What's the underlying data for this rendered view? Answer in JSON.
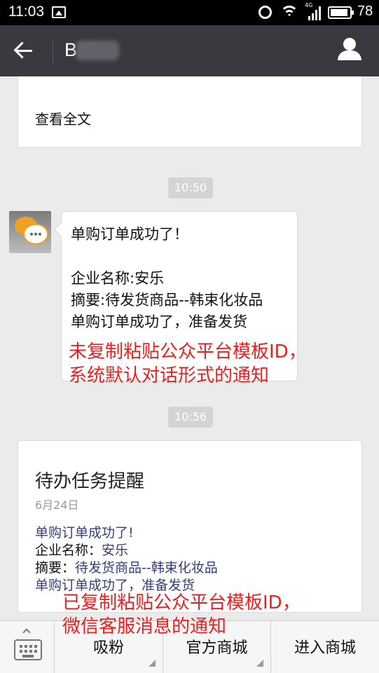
{
  "status_bar": {
    "time": "11:03",
    "network_label": "4G",
    "battery_level": "78"
  },
  "title_bar": {
    "chat_title": "B     S"
  },
  "messages": {
    "top_card": {
      "read_more": "查看全文"
    },
    "timestamp_1": "10:50",
    "bubble_lines": [
      "单购订单成功了！",
      "企业名称:安乐",
      "摘要:待发货商品--韩束化妆品",
      "单购订单成功了，准备发货"
    ],
    "annotation_1": [
      "未复制粘贴公众平台模板ID，",
      "系统默认对话形式的通知"
    ],
    "timestamp_2": "10:56",
    "template_card": {
      "title": "待办任务提醒",
      "date": "6月24日",
      "first": "单购订单成功了!",
      "company_key": "企业名称：",
      "company_val": "安乐",
      "summary_key": "摘要：",
      "summary_val": "待发货商品--韩束化妆品",
      "remark": "单购订单成功了，准备发货"
    },
    "annotation_2": [
      "已复制粘贴公众平台模板ID，",
      "微信客服消息的通知"
    ]
  },
  "bottom_menu": {
    "keyboard_icon": "keyboard-icon",
    "items": [
      "吸粉",
      "官方商城",
      "进入商城"
    ]
  },
  "colors": {
    "title_bar_bg": "#393a3f",
    "annotation_red": "#ef1d1d",
    "template_blue": "#333e7a",
    "chat_bg": "#ebebeb"
  }
}
